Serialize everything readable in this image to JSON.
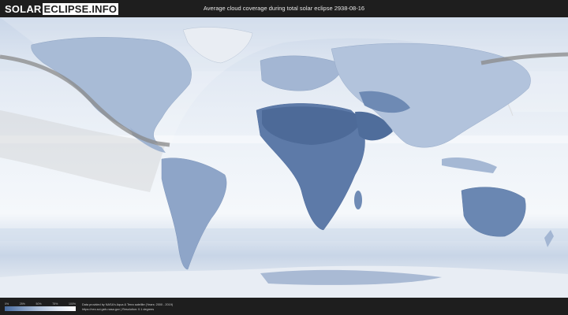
{
  "header": {
    "logo_part1": "SOLAR",
    "logo_part2": "ECLIPSE.INFO",
    "title": "Average cloud coverage during total solar eclipse 2938-08-16"
  },
  "legend": {
    "ticks": [
      "0%",
      "25%",
      "50%",
      "75%",
      "100%"
    ],
    "colors": [
      "#476b9f",
      "#7f99bf",
      "#b3c4dc",
      "#dfe7f2",
      "#ffffff"
    ]
  },
  "credits": {
    "line1": "Data provided by NASA's Aqua & Terra satellite (Years: 2000 - 2019)",
    "line2": "https://neo.sci.gsfc.nasa.gov | Resolution: 0.1 degrees"
  },
  "map": {
    "ocean_color": "#eef3f9",
    "land_dark_color": "#5a77a3",
    "eclipse_path_color": "#8a8a8a"
  }
}
